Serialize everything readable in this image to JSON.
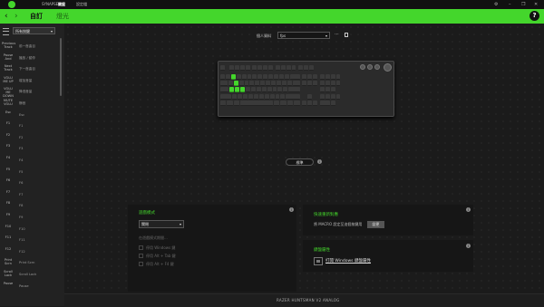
{
  "titlebar": {
    "tabs": [
      "SYNAPSE",
      "鍵盤",
      "設定檔"
    ],
    "active_tab": 1,
    "window_controls": [
      "gear-icon",
      "minimize-icon",
      "restore-icon",
      "close-icon"
    ]
  },
  "header": {
    "back": "‹",
    "forward": "›",
    "tabs": [
      "自訂",
      "燈光"
    ],
    "help": "?"
  },
  "sidebar": {
    "select": "所有按鍵",
    "rows": [
      {
        "key": "Previous Track",
        "value": "前一首曲目"
      },
      {
        "key": "Pause And",
        "value": "播放 / 暫停"
      },
      {
        "key": "Next Track",
        "value": "下一首曲目"
      },
      {
        "key": "VOLU ME UP",
        "value": "增加音量"
      },
      {
        "key": "VOLU ME DOWN",
        "value": "降低音量"
      },
      {
        "key": "MUTE VOLU",
        "value": "靜音"
      },
      {
        "key": "Esc",
        "value": "Esc"
      },
      {
        "key": "F1",
        "value": "F1"
      },
      {
        "key": "F2",
        "value": "F2"
      },
      {
        "key": "F3",
        "value": "F3"
      },
      {
        "key": "F4",
        "value": "F4"
      },
      {
        "key": "F5",
        "value": "F5"
      },
      {
        "key": "F6",
        "value": "F6"
      },
      {
        "key": "F7",
        "value": "F7"
      },
      {
        "key": "F8",
        "value": "F8"
      },
      {
        "key": "F9",
        "value": "F9"
      },
      {
        "key": "F10",
        "value": "F10"
      },
      {
        "key": "F11",
        "value": "F11"
      },
      {
        "key": "F12",
        "value": "F12"
      },
      {
        "key": "Print Scrn",
        "value": "Print Scrn"
      },
      {
        "key": "Scroll Lock",
        "value": "Scroll Lock"
      },
      {
        "key": "Pause",
        "value": "Pause"
      }
    ]
  },
  "profile": {
    "label": "個人資料",
    "value": "fps",
    "more": "···"
  },
  "standard_button": "標準",
  "game_mode": {
    "title": "遊戲模式",
    "select": "關閉",
    "subtitle": "在遊戲模式期間...",
    "options": [
      "停用 Windows 鍵",
      "停用 Alt + Tab 鍵",
      "停用 Alt + F4 鍵"
    ]
  },
  "quick_switch": {
    "title": "快速重新對應",
    "text": "將 MACRO 設定至這個按鍵用",
    "button": "變更"
  },
  "keyboard_properties": {
    "title": "鍵盤屬性",
    "link": "打開 Windows 鍵盤屬性"
  },
  "device_name": "RAZER HUNTSMAN V2 ANALOG",
  "colors": {
    "accent": "#44d62c",
    "background": "#1b1b1b",
    "panel": "#161616"
  }
}
